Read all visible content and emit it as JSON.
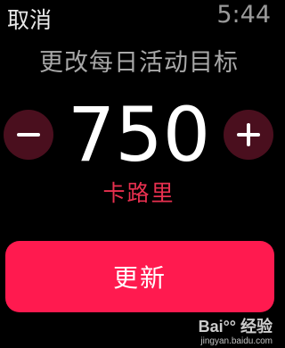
{
  "status_bar": {
    "cancel_label": "取消",
    "time": "5:44"
  },
  "title": "更改每日活动目标",
  "goal": {
    "value": "750",
    "unit": "卡路里"
  },
  "controls": {
    "decrement_icon": "minus-icon",
    "increment_icon": "plus-icon"
  },
  "update_button": {
    "label": "更新"
  },
  "watermark": {
    "logo": "Bai°° 经验",
    "url": "jingyan.baidu.com"
  },
  "colors": {
    "accent": "#ff1a4f",
    "unit_text": "#e8304f",
    "circle_button_bg": "#4a0f1e"
  }
}
